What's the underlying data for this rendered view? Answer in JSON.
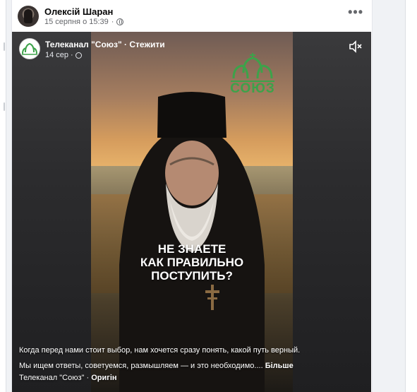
{
  "post": {
    "author": "Олексій Шаран",
    "timestamp": "15 серпня о 15:39",
    "separator": "·",
    "more_label": "•••"
  },
  "reel": {
    "page_name": "Телеканал \"Союз\"",
    "dot": "·",
    "follow_label": "Стежити",
    "date": "14 сер",
    "logo_text": "СОЮЗ",
    "headline": [
      "НЕ ЗНАЕТЕ",
      "КАК ПРАВИЛЬНО",
      "ПОСТУПИТЬ?"
    ],
    "caption_line1": "Когда перед нами стоит выбор, нам хочется сразу понять, какой путь верный.",
    "caption_line2": "Мы ищем ответы, советуемся, размышляем — и это необходимо....",
    "caption_more": "Більше",
    "audio_source": "Телеканал \"Союз\"",
    "audio_label": "Оригін",
    "mute_icon": "speaker-muted-icon"
  },
  "colors": {
    "brand_green": "#3da24a",
    "text_primary": "#050505",
    "text_secondary": "#65676b"
  }
}
